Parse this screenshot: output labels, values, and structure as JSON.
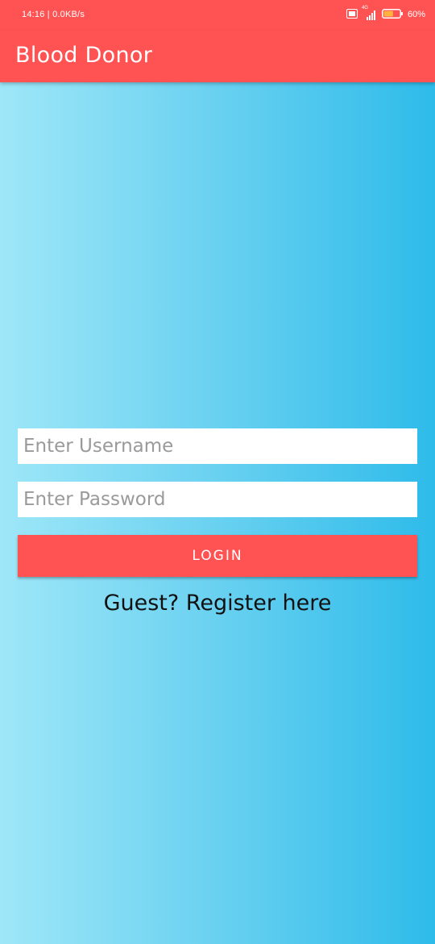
{
  "status_bar": {
    "time_text": "14:16 | 0.0KB/s",
    "network_text": "4G",
    "battery_text": "60%",
    "battery_level": 0.6
  },
  "app_bar": {
    "title": "Blood Donor",
    "color": "#ff5252"
  },
  "login_form": {
    "username_placeholder": "Enter Username",
    "password_placeholder": "Enter Password",
    "login_label": "LOGIN",
    "register_label": "Guest? Register here"
  },
  "colors": {
    "accent": "#ff5252",
    "gradient_start": "#9ee7f8",
    "gradient_end": "#2ebbea"
  },
  "icons": [
    "volte-icon",
    "signal-icon",
    "battery-icon"
  ]
}
